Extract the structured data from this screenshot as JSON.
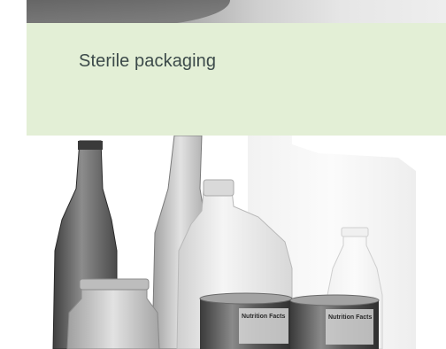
{
  "caption": {
    "title": "Sterile packaging"
  },
  "photo": {
    "subject": "glass bottles, plastic jugs and aluminum cans",
    "can_labels": [
      "Nutrition Facts",
      "Nutrition Facts"
    ]
  },
  "colors": {
    "caption_background": "#e3efd6",
    "caption_text": "#3c4a4a"
  }
}
